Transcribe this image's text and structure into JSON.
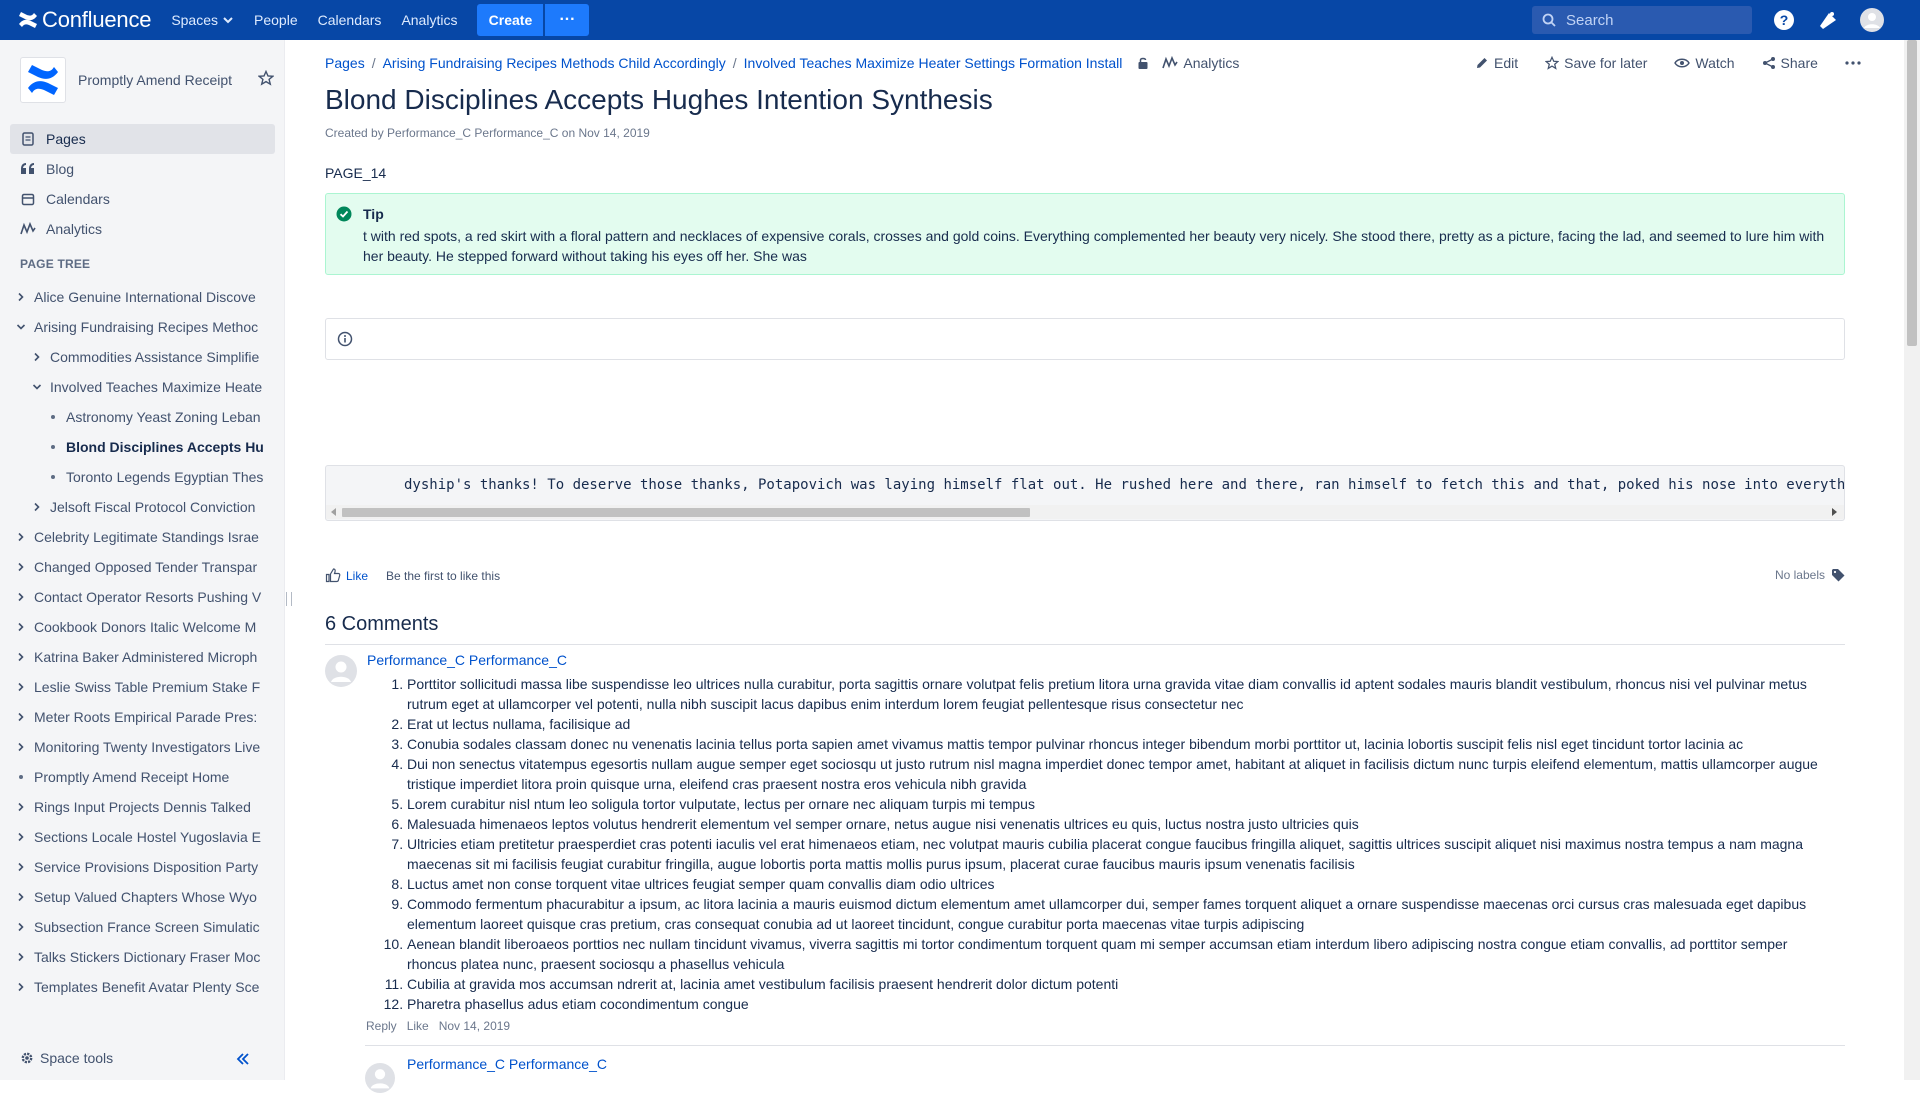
{
  "topnav": {
    "product": "Confluence",
    "items": [
      "Spaces",
      "People",
      "Calendars",
      "Analytics"
    ],
    "create_label": "Create",
    "more_label": "···",
    "search_placeholder": "Search",
    "icons": [
      "help-icon",
      "notifications-icon",
      "user-avatar-icon"
    ],
    "bg_color": "#0747a6"
  },
  "sidebar": {
    "space_name": "Promptly Amend Receipt",
    "nav": [
      "Pages",
      "Blog",
      "Calendars",
      "Analytics"
    ],
    "page_tree_title": "PAGE TREE",
    "tree": [
      "Alice Genuine International Discove",
      "Arising Fundraising Recipes Methoc",
      "Commodities Assistance Simplifie",
      "Involved Teaches Maximize Heate",
      "Astronomy Yeast Zoning Leban",
      "Blond Disciplines Accepts Hu",
      "Toronto Legends Egyptian Thes",
      "Jelsoft Fiscal Protocol Conviction",
      "Celebrity Legitimate Standings Israe",
      "Changed Opposed Tender Transpar",
      "Contact Operator Resorts Pushing V",
      "Cookbook Donors Italic Welcome M",
      "Katrina Baker Administered Microph",
      "Leslie Swiss Table Premium Stake F",
      "Meter Roots Empirical Parade Pres:",
      "Monitoring Twenty Investigators Live",
      "Promptly Amend Receipt Home",
      "Rings Input Projects Dennis Talked",
      "Sections Locale Hostel Yugoslavia E",
      "Service Provisions Disposition Party",
      "Setup Valued Chapters Whose Wyo",
      "Subsection France Screen Simulatic",
      "Talks Stickers Dictionary Fraser Moc",
      "Templates Benefit Avatar Plenty Sce"
    ],
    "space_tools": "Space tools"
  },
  "main": {
    "breadcrumb": [
      "Pages",
      "Arising Fundraising Recipes Methods Child Accordingly",
      "Involved Teaches Maximize Heater Settings Formation Install"
    ],
    "breadcrumb_sep": "/",
    "breadcrumb_analytics": "Analytics",
    "actions": [
      "Edit",
      "Save for later",
      "Watch",
      "Share"
    ],
    "title": "Blond Disciplines Accepts Hughes Intention Synthesis",
    "byline": "Created by Performance_C Performance_C on Nov 14, 2019",
    "page_label": "PAGE_14",
    "tip": {
      "title": "Tip",
      "body": "t with red spots, a red skirt with a floral pattern and necklaces of expensive corals, crosses and gold coins. Everything complemented her beauty very nicely. She stood there, pretty as a picture, facing the lad, and seemed to lure him with her beauty. He stepped forward without taking his eyes off her. She was"
    },
    "code": "dyship's thanks! To deserve those thanks, Potapovich was laying himself flat out. He rushed here and there, ran himself to fetch this and that, poked his nose into everythi",
    "like_label": "Like",
    "like_hint": "Be the first to like this",
    "labels_text": "No labels",
    "comments_title": "6 Comments",
    "comments": [
      {
        "author": "Performance_C Performance_C",
        "items": [
          "Porttitor sollicitudi massa libe suspendisse leo ultrices nulla curabitur, porta sagittis ornare volutpat felis pretium litora urna gravida vitae diam convallis id aptent sodales mauris blandit vestibulum, rhoncus nisi vel pulvinar metus rutrum eget at ullamcorper vel potenti, nulla nibh suscipit lacus dapibus enim interdum lorem feugiat pellentesque risus consectetur nec",
          "Erat ut lectus nullama, facilisique ad",
          "Conubia sodales classam donec nu venenatis lacinia tellus porta sapien amet vivamus mattis tempor pulvinar rhoncus integer bibendum morbi porttitor ut, lacinia lobortis suscipit felis nisl eget tincidunt tortor lacinia ac",
          "Dui non senectus vitatempus egesortis nullam augue semper eget sociosqu ut justo rutrum nisl magna imperdiet donec tempor amet, habitant at aliquet in facilisis dictum nunc turpis eleifend elementum, mattis ullamcorper augue tristique imperdiet litora proin quisque urna, eleifend cras praesent nostra eros vehicula nibh gravida",
          "Lorem curabitur nisl ntum leo soligula tortor vulputate, lectus per ornare nec aliquam turpis mi tempus",
          "Malesuada himenaeos leptos volutus hendrerit elementum vel semper ornare, netus augue nisi venenatis ultrices eu quis, luctus nostra justo ultricies quis",
          "Ultricies etiam pretitetur praesperdiet cras potenti iaculis vel erat himenaeos etiam, nec volutpat mauris cubilia placerat congue faucibus fringilla aliquet, sagittis ultrices suscipit aliquet nisi maximus nostra tempus a nam magna maecenas sit mi facilisis feugiat curabitur fringilla, augue lobortis porta mattis mollis purus ipsum, placerat curae faucibus mauris ipsum venenatis facilisis",
          "Luctus amet non conse torquent vitae ultrices feugiat semper quam convallis diam odio ultrices",
          "Commodo fermentum phacurabitur a ipsum, ac litora lacinia a mauris euismod dictum elementum amet ullamcorper dui, semper fames torquent aliquet a ornare suspendisse maecenas orci cursus cras malesuada eget dapibus elementum laoreet quisque cras pretium, cras consequat conubia ad ut laoreet tincidunt, congue curabitur porta maecenas vitae turpis adipiscing",
          "Aenean blandit liberoaeos porttios nec nullam tincidunt vivamus, viverra sagittis mi tortor condimentum torquent quam mi semper accumsan etiam interdum libero adipiscing nostra congue etiam convallis, ad porttitor semper rhoncus platea nunc, praesent sociosqu a phasellus vehicula",
          "Cubilia at gravida mos accumsan ndrerit at, lacinia amet vestibulum facilisis praesent hendrerit dolor dictum potenti",
          "Pharetra phasellus adus etiam cocondimentum congue"
        ],
        "reply_label": "Reply",
        "like_label": "Like",
        "date": "Nov 14, 2019"
      },
      {
        "author": "Performance_C Performance_C"
      }
    ],
    "tip_color": "#e3fcef",
    "link_color": "#0052cc"
  }
}
